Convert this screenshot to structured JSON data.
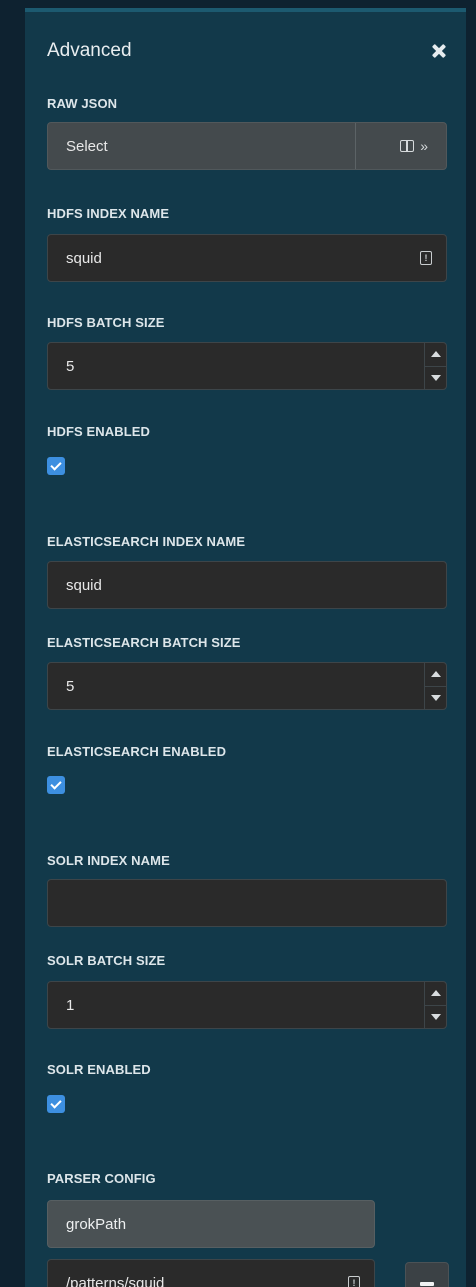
{
  "panel": {
    "title": "Advanced"
  },
  "raw_json": {
    "label": "RAW JSON",
    "value": "Select",
    "icons": [
      "panel-icon",
      "double-chevron-right-icon"
    ],
    "chevron_glyph": "»"
  },
  "hdfs_index_name": {
    "label": "HDFS INDEX NAME",
    "value": "squid",
    "icon": "info-icon",
    "icon_glyph": "!"
  },
  "hdfs_batch_size": {
    "label": "HDFS BATCH SIZE",
    "value": "5"
  },
  "hdfs_enabled": {
    "label": "HDFS ENABLED",
    "checked": true
  },
  "es_index_name": {
    "label": "ELASTICSEARCH INDEX NAME",
    "value": "squid"
  },
  "es_batch_size": {
    "label": "ELASTICSEARCH BATCH SIZE",
    "value": "5"
  },
  "es_enabled": {
    "label": "ELASTICSEARCH ENABLED",
    "checked": true
  },
  "solr_index_name": {
    "label": "SOLR INDEX NAME",
    "value": ""
  },
  "solr_batch_size": {
    "label": "SOLR BATCH SIZE",
    "value": "1"
  },
  "solr_enabled": {
    "label": "SOLR ENABLED",
    "checked": true
  },
  "parser_config": {
    "label": "PARSER CONFIG",
    "key": "grokPath",
    "value": "/patterns/squid",
    "value_icon": "info-icon",
    "value_icon_glyph": "!"
  },
  "colors": {
    "panel_bg": "#12394a",
    "page_bg": "#0e2230",
    "input_bg": "#2a2a2a",
    "checkbox_accent": "#3d8fe0"
  }
}
